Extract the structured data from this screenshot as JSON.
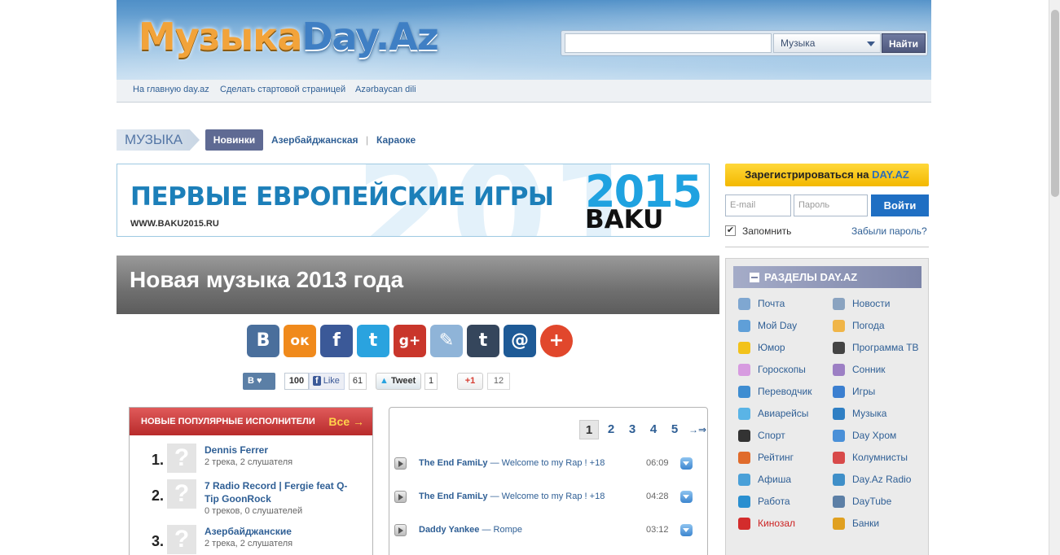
{
  "header": {
    "logo_part1": "Музыка",
    "logo_part2": "Day.Az",
    "search_placeholder": "",
    "search_category": "Музыка",
    "search_button": "Найти"
  },
  "topnav": [
    "На главную day.az",
    "Сделать стартовой страницей",
    "Azərbaycan dili"
  ],
  "section_nav": {
    "tag": "МУЗЫКА",
    "tabs": [
      "Новинки",
      "Азербайджанская",
      "Караоке"
    ],
    "separator": "|"
  },
  "banner": {
    "headline": "ПЕРВЫЕ ЕВРОПЕЙСКИЕ ИГРЫ",
    "url": "WWW.BAKU2015.RU",
    "year": "2015",
    "city": "BAKU"
  },
  "page_title": "Новая музыка 2013 года",
  "share": {
    "icons": [
      {
        "name": "vk-icon",
        "glyph": "В",
        "color": "#4a6f9c"
      },
      {
        "name": "odnoklassniki-icon",
        "glyph": "ок",
        "color": "#f08a1c"
      },
      {
        "name": "facebook-icon",
        "glyph": "f",
        "color": "#3b5998"
      },
      {
        "name": "twitter-icon",
        "glyph": "t",
        "color": "#2aa3df"
      },
      {
        "name": "google-plus-icon",
        "glyph": "g+",
        "color": "#c9362b"
      },
      {
        "name": "livejournal-icon",
        "glyph": "✎",
        "color": "#8fb4d8"
      },
      {
        "name": "tumblr-icon",
        "glyph": "t",
        "color": "#35465c"
      },
      {
        "name": "mail-icon",
        "glyph": "@",
        "color": "#1e5a96"
      },
      {
        "name": "more-icon",
        "glyph": "+",
        "color": "#e1472c"
      }
    ],
    "counters": {
      "vk_label": "В ♥",
      "vk_count": "100",
      "fb_like": "Like",
      "fb_count": "61",
      "tweet": "Tweet",
      "tweet_count": "1",
      "gplus": "+1",
      "gplus_count": "12"
    }
  },
  "popular": {
    "title": "НОВЫЕ ПОПУЛЯРНЫЕ ИСПОЛНИТЕЛИ",
    "all_link": "Все →",
    "artists": [
      {
        "num": "1.",
        "name": "Dennis Ferrer",
        "stats": "2 трека, 2 слушателя"
      },
      {
        "num": "2.",
        "name": "7 Radio Record | Fergie feat Q-Tip GoonRock",
        "stats": "0 треков, 0 слушателей"
      },
      {
        "num": "3.",
        "name": "Азербайджанские",
        "stats": "2 трека, 2 слушателя"
      }
    ]
  },
  "tracks": {
    "pages": [
      "1",
      "2",
      "3",
      "4",
      "5",
      "→⇒"
    ],
    "current_page": "1",
    "items": [
      {
        "artist": "The End FamiLy",
        "song": " — Welcome to my Rap ! +18",
        "duration": "06:09"
      },
      {
        "artist": "The End FamiLy",
        "song": " — Welcome to my Rap ! +18",
        "duration": "04:28"
      },
      {
        "artist": "Daddy Yankee",
        "song": " — Rompe",
        "duration": "03:12"
      }
    ]
  },
  "login": {
    "register_prefix": "Зарегистрироваться на ",
    "register_brand": "DAY.AZ",
    "email_placeholder": "E-mail",
    "password_placeholder": "Пароль",
    "login_button": "Войти",
    "remember": "Запомнить",
    "forgot": "Забыли пароль?"
  },
  "sections": {
    "title": "РАЗДЕЛЫ DAY.AZ",
    "left": [
      {
        "label": "Почта",
        "icon": "mail-icon",
        "color": "#7fa7d1"
      },
      {
        "label": "Мой Day",
        "icon": "user-icon",
        "color": "#5f9fd8"
      },
      {
        "label": "Юмор",
        "icon": "smile-icon",
        "color": "#f2c21b"
      },
      {
        "label": "Гороскопы",
        "icon": "star-icon",
        "color": "#d79be0"
      },
      {
        "label": "Переводчик",
        "icon": "book-icon",
        "color": "#3f8dd1"
      },
      {
        "label": "Авиарейсы",
        "icon": "plane-icon",
        "color": "#5ab4e6"
      },
      {
        "label": "Спорт",
        "icon": "ball-icon",
        "color": "#333333"
      },
      {
        "label": "Рейтинг",
        "icon": "chart-icon",
        "color": "#e06b2b"
      },
      {
        "label": "Афиша",
        "icon": "poster-icon",
        "color": "#4aa0d8"
      },
      {
        "label": "Работа",
        "icon": "briefcase-icon",
        "color": "#2a8fd0"
      },
      {
        "label": "Кинозал",
        "icon": "camera-icon",
        "color": "#d32c2c",
        "red": true
      }
    ],
    "right": [
      {
        "label": "Новости",
        "icon": "news-icon",
        "color": "#8aa3c0"
      },
      {
        "label": "Погода",
        "icon": "weather-icon",
        "color": "#f0b548"
      },
      {
        "label": "Программа ТВ",
        "icon": "tv-icon",
        "color": "#444444"
      },
      {
        "label": "Сонник",
        "icon": "moon-icon",
        "color": "#9c7fc4"
      },
      {
        "label": "Игры",
        "icon": "games-icon",
        "color": "#3b7fd0"
      },
      {
        "label": "Музыка",
        "icon": "music-icon",
        "color": "#2f7fc4"
      },
      {
        "label": "Day Хром",
        "icon": "browser-icon",
        "color": "#4a90d8"
      },
      {
        "label": "Колумнисты",
        "icon": "pen-icon",
        "color": "#d84a4a"
      },
      {
        "label": "Day.Az Radio",
        "icon": "radio-icon",
        "color": "#3f8fc8"
      },
      {
        "label": "DayTube",
        "icon": "monitor-icon",
        "color": "#5c7fa6"
      },
      {
        "label": "Банки",
        "icon": "bank-icon",
        "color": "#e0a020"
      }
    ]
  }
}
